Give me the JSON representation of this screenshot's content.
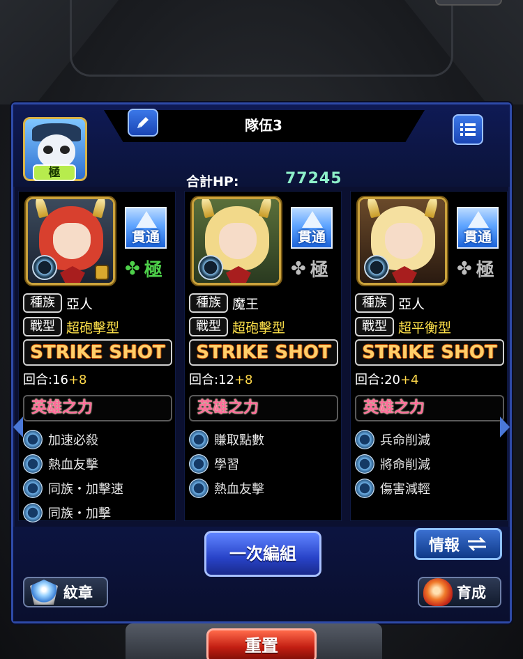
{
  "team": {
    "title": "隊伍3",
    "total_hp_label": "合計HP:",
    "total_hp_value": "77245",
    "leader_badge": "極"
  },
  "members": [
    {
      "pierce_label": "貫通",
      "luck_level": "極",
      "luck_active": true,
      "race_label": "種族",
      "race_value": "亞人",
      "type_label": "戰型",
      "type_value": "超砲擊型",
      "strike_shot_label": "STRIKE SHOT",
      "turns_label": "回合:16",
      "turns_plus": "+8",
      "hero_power_label": "英雄之力",
      "abilities": [
        "加速必殺",
        "熱血友擊",
        "同族・加擊速",
        "同族・加擊"
      ]
    },
    {
      "pierce_label": "貫通",
      "luck_level": "極",
      "luck_active": false,
      "race_label": "種族",
      "race_value": "魔王",
      "type_label": "戰型",
      "type_value": "超砲擊型",
      "strike_shot_label": "STRIKE SHOT",
      "turns_label": "回合:12",
      "turns_plus": "+8",
      "hero_power_label": "英雄之力",
      "abilities": [
        "賺取點數",
        "學習",
        "熱血友擊"
      ]
    },
    {
      "pierce_label": "貫通",
      "luck_level": "極",
      "luck_active": false,
      "race_label": "種族",
      "race_value": "亞人",
      "type_label": "戰型",
      "type_value": "超平衡型",
      "strike_shot_label": "STRIKE SHOT",
      "turns_label": "回合:20",
      "turns_plus": "+4",
      "hero_power_label": "英雄之力",
      "abilities": [
        "兵命削減",
        "將命削減",
        "傷害減輕"
      ]
    }
  ],
  "buttons": {
    "group_once": "一次編組",
    "info": "情報",
    "badge": "紋章",
    "grow": "育成",
    "reset": "重置"
  },
  "colors": {
    "panel_border": "#2e4aa8",
    "hp_value": "#8ef0c9",
    "type_value": "#ffe24a",
    "luck_active": "#4ed04a",
    "luck_inactive": "#bdbdbd",
    "hero_power": "#ff6b9a"
  },
  "icons": {
    "edit": "pencil-icon",
    "menu": "list-icon",
    "info_swap": "swap-arrows-icon",
    "luck": "clover-icon",
    "ability": "ability-gem-icon",
    "lock": "lock-icon"
  }
}
